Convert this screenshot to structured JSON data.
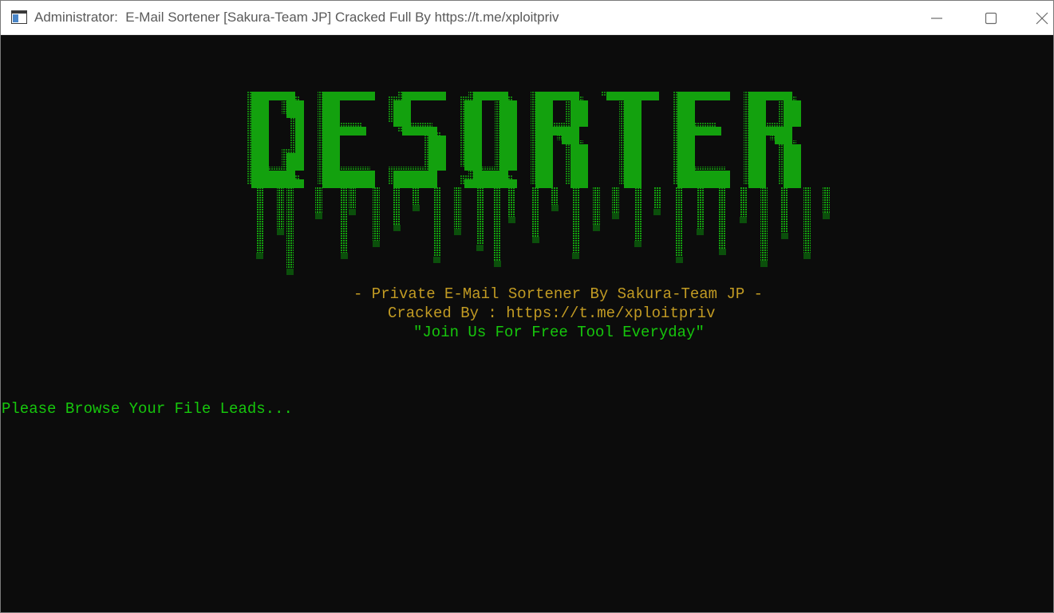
{
  "window": {
    "title": "Administrator:  E-Mail Sortener [Sakura-Team JP] Cracked Full By https://t.me/xploitpriv",
    "icon": "console-icon",
    "controls": [
      "minimize-icon",
      "maximize-icon",
      "close-icon"
    ]
  },
  "banner": {
    "text": "DESORTER",
    "style": "dripping ascii art",
    "color": "#13a10e"
  },
  "console": {
    "subtitle": "- Private E-Mail Sortener By Sakura-Team JP -",
    "cracked_by": "Cracked By : https://t.me/xploitpriv",
    "join": "\"Join Us For Free Tool Everyday\"",
    "prompt": "Please Browse Your File Leads..."
  },
  "colors": {
    "background": "#0c0c0c",
    "accent_yellow": "#c29b23",
    "accent_green": "#16c60c",
    "banner_green": "#13a10e"
  }
}
